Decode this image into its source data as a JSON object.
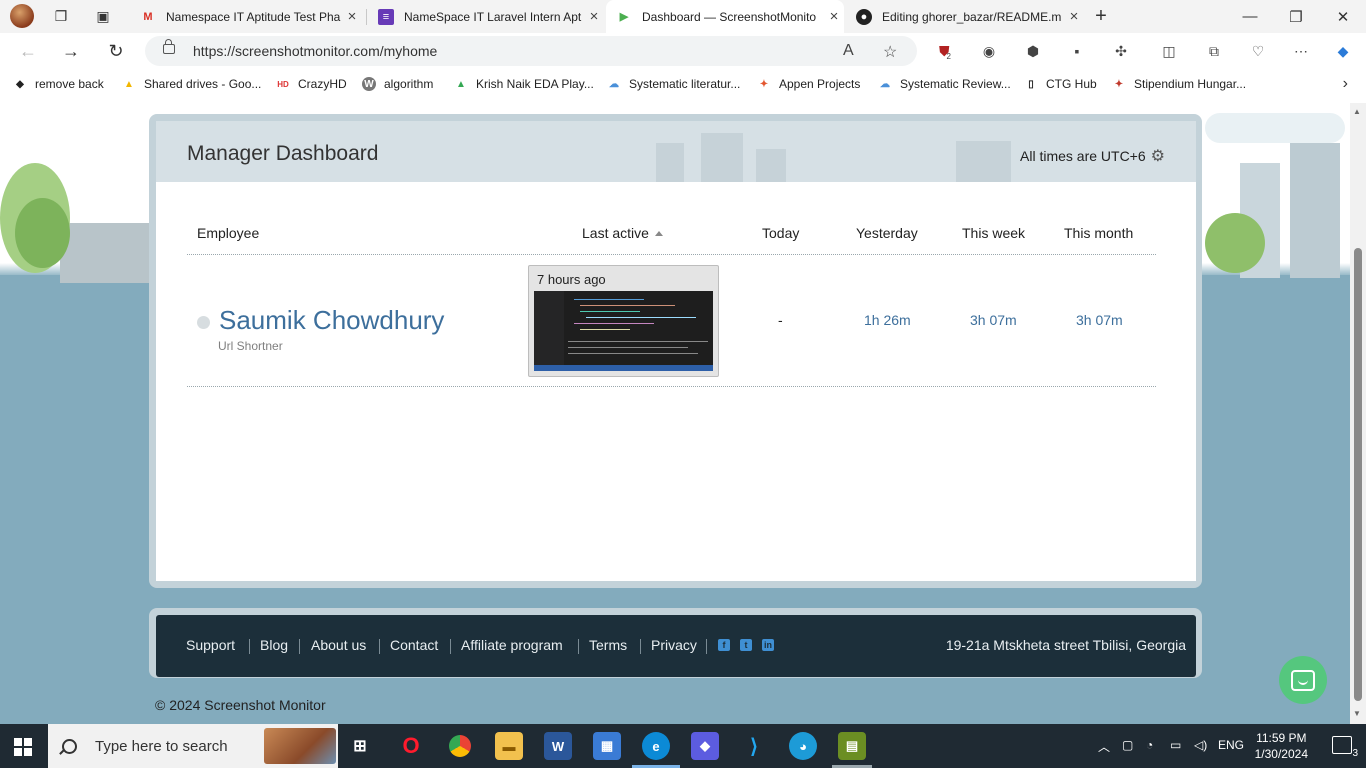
{
  "browser": {
    "tabs": [
      {
        "title": "Namespace IT Aptitude Test Pha",
        "favicon": "gmail-icon",
        "active": false
      },
      {
        "title": "NameSpace IT Laravel Intern Apt",
        "favicon": "forms-icon",
        "active": false
      },
      {
        "title": "Dashboard — ScreenshotMonito",
        "favicon": "play-icon",
        "active": true
      },
      {
        "title": "Editing ghorer_bazar/README.m",
        "favicon": "github-icon",
        "active": false
      }
    ],
    "url": "https://screenshotmonitor.com/myhome",
    "extension_badges": {
      "shield": "2"
    },
    "bookmarks": [
      "remove back",
      "Shared drives - Goo...",
      "CrazyHD",
      "algorithm",
      "Krish Naik EDA Play...",
      "Systematic literatur...",
      "Appen Projects",
      "Systematic Review...",
      "CTG Hub",
      "Stipendium Hungar..."
    ]
  },
  "dashboard": {
    "title": "Manager Dashboard",
    "timezone_note": "All times are UTC+6",
    "columns": {
      "employee": "Employee",
      "last_active": "Last active",
      "today": "Today",
      "yesterday": "Yesterday",
      "this_week": "This week",
      "this_month": "This month"
    },
    "rows": [
      {
        "name": "Saumik Chowdhury",
        "project": "Url Shortner",
        "last_active": "7 hours ago",
        "today": "-",
        "yesterday": "1h 26m",
        "this_week": "3h 07m",
        "this_month": "3h 07m"
      }
    ]
  },
  "footer": {
    "links": [
      "Support",
      "Blog",
      "About us",
      "Contact",
      "Affiliate program",
      "Terms",
      "Privacy"
    ],
    "social": [
      "facebook-icon",
      "twitter-icon",
      "linkedin-icon"
    ],
    "address": "19-21a Mtskheta street Tbilisi, Georgia",
    "copyright": "© 2024 Screenshot Monitor"
  },
  "taskbar": {
    "search_placeholder": "Type here to search",
    "language": "ENG",
    "time": "11:59 PM",
    "date": "1/30/2024",
    "notification_count": "3"
  },
  "colors": {
    "accent_link": "#3d6f9c",
    "footer_bg": "#1c2f3a",
    "chat_button": "#55c77e",
    "page_sky": "#83abbd"
  }
}
